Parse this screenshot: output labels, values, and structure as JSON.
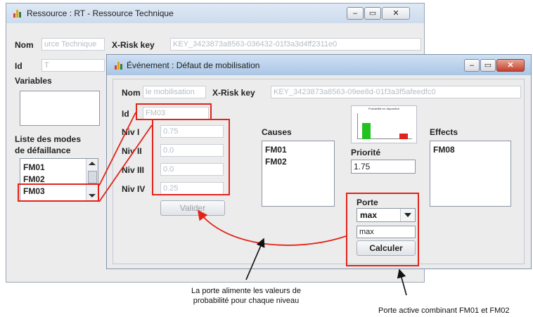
{
  "background_window": {
    "title": "Ressource : RT - Ressource Technique",
    "nom_label": "Nom",
    "nom_value": "urce Technique",
    "xrisk_label": "X-Risk key",
    "xrisk_value": "KEY_3423873a8563-036432-01f3a3d4ff2311e0",
    "id_label": "Id",
    "id_value": "T",
    "variables_label": "Variables",
    "modes_label_1": "Liste des modes",
    "modes_label_2": "de défaillance",
    "modes": [
      "FM01",
      "FM02",
      "FM03"
    ],
    "selected_mode": "FM03"
  },
  "dialog": {
    "title": "Événement : Défaut de mobilisation",
    "nom_label": "Nom",
    "nom_value": "le mobilisation",
    "xrisk_label": "X-Risk key",
    "xrisk_value": "KEY_3423873a8563-09ee8d-01f3a3f5afeedfc0",
    "id_label": "Id",
    "id_value": "FM03",
    "levels": [
      {
        "label": "Niv I",
        "value": "0.75"
      },
      {
        "label": "Niv II",
        "value": "0.0"
      },
      {
        "label": "Niv III",
        "value": "0.0"
      },
      {
        "label": "Niv IV",
        "value": "0.25"
      }
    ],
    "validate_label": "Valider",
    "causes_label": "Causes",
    "causes": [
      "FM01",
      "FM02"
    ],
    "priority_label": "Priorité",
    "priority_value": "1.75",
    "effects_label": "Effects",
    "effects": [
      "FM08"
    ],
    "porte_label": "Porte",
    "porte_selected": "max",
    "porte_field_value": "max",
    "calculate_label": "Calculer",
    "thumbnail": {
      "title": "Probabilité en dispositive",
      "bars": [
        {
          "value": 0.75,
          "color": "#1fc21f"
        },
        {
          "value": 0.25,
          "color": "#e3221b"
        }
      ]
    }
  },
  "annotations": {
    "left": [
      "La porte alimente les valeurs de",
      "probabilité pour chaque niveau"
    ],
    "right": "Porte active combinant FM01 et FM02"
  },
  "colors": {
    "highlight": "#e2231a",
    "window_bg": "#ececec",
    "title_accent": "#9cc3e6"
  }
}
